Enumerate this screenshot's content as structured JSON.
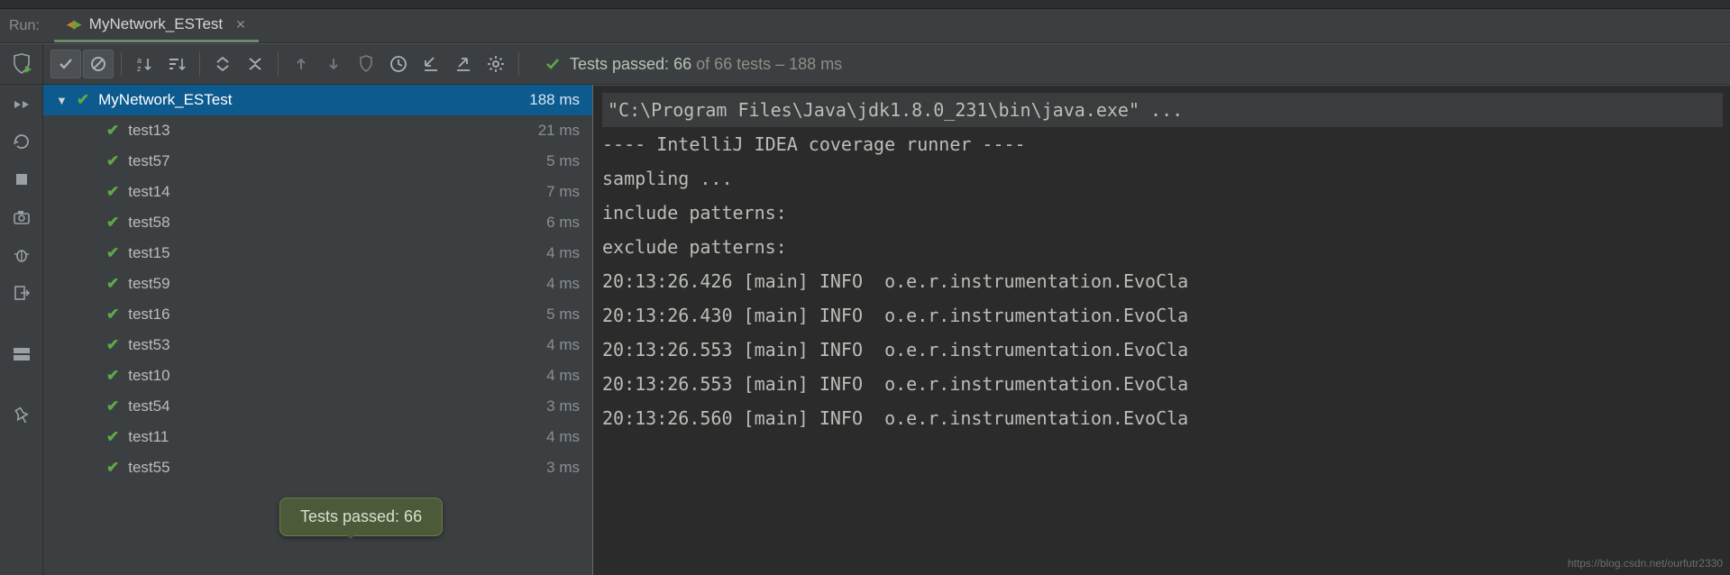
{
  "run_label": "Run:",
  "tab": {
    "title": "MyNetwork_ESTest"
  },
  "status": {
    "prefix": "Tests passed: ",
    "passed": "66",
    "mid": " of 66 tests – ",
    "time": "188 ms"
  },
  "tree": {
    "root": {
      "name": "MyNetwork_ESTest",
      "time": "188 ms"
    },
    "tests": [
      {
        "name": "test13",
        "time": "21 ms"
      },
      {
        "name": "test57",
        "time": "5 ms"
      },
      {
        "name": "test14",
        "time": "7 ms"
      },
      {
        "name": "test58",
        "time": "6 ms"
      },
      {
        "name": "test15",
        "time": "4 ms"
      },
      {
        "name": "test59",
        "time": "4 ms"
      },
      {
        "name": "test16",
        "time": "5 ms"
      },
      {
        "name": "test53",
        "time": "4 ms"
      },
      {
        "name": "test10",
        "time": "4 ms"
      },
      {
        "name": "test54",
        "time": "3 ms"
      },
      {
        "name": "test11",
        "time": "4 ms"
      },
      {
        "name": "test55",
        "time": "3 ms"
      }
    ]
  },
  "console": [
    "\"C:\\Program Files\\Java\\jdk1.8.0_231\\bin\\java.exe\" ...",
    "---- IntelliJ IDEA coverage runner ---- ",
    "sampling ...",
    "include patterns:",
    "exclude patterns:",
    "20:13:26.426 [main] INFO  o.e.r.instrumentation.EvoCla",
    "20:13:26.430 [main] INFO  o.e.r.instrumentation.EvoCla",
    "20:13:26.553 [main] INFO  o.e.r.instrumentation.EvoCla",
    "20:13:26.553 [main] INFO  o.e.r.instrumentation.EvoCla",
    "20:13:26.560 [main] INFO  o.e.r.instrumentation.EvoCla"
  ],
  "tooltip": "Tests passed: 66",
  "watermark": "https://blog.csdn.net/ourfutr2330"
}
